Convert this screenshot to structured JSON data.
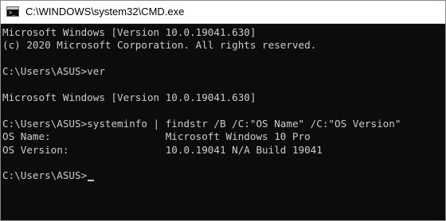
{
  "window": {
    "title": "C:\\WINDOWS\\system32\\CMD.exe",
    "icon": "command-prompt-icon"
  },
  "console": {
    "colors": {
      "background": "#0c0c0c",
      "text": "#cccccc"
    },
    "lines": [
      "Microsoft Windows [Version 10.0.19041.630]",
      "(c) 2020 Microsoft Corporation. All rights reserved.",
      "",
      "C:\\Users\\ASUS>ver",
      "",
      "Microsoft Windows [Version 10.0.19041.630]",
      "",
      "C:\\Users\\ASUS>systeminfo | findstr /B /C:\"OS Name\" /C:\"OS Version\"",
      "OS Name:                   Microsoft Windows 10 Pro",
      "OS Version:                10.0.19041 N/A Build 19041",
      ""
    ],
    "prompt": "C:\\Users\\ASUS>"
  }
}
